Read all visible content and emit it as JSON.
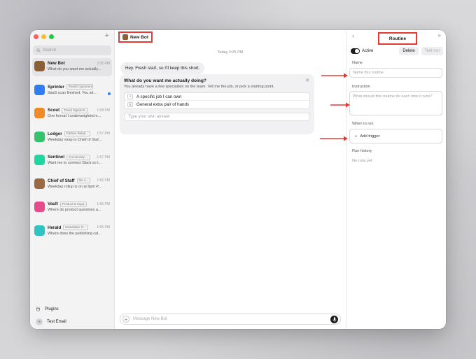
{
  "sidebar": {
    "search_placeholder": "Search",
    "bots": [
      {
        "name": "New Bot",
        "tag": "",
        "time": "2:25 PM",
        "preview": "What do you want me actually...",
        "color": "#8b5e34",
        "active": true,
        "unread": false
      },
      {
        "name": "Sprinter",
        "tag": "Reddit Opportunit...",
        "time": "",
        "preview": "SaaS scan finished. You alr...",
        "color": "#2f7cf6",
        "active": false,
        "unread": true
      },
      {
        "name": "Scout",
        "tag": "Trend Signal R...",
        "time": "1:58 PM",
        "preview": "One format I underweighted o...",
        "color": "#f08a24",
        "active": false,
        "unread": false
      },
      {
        "name": "Ledger",
        "tag": "Partner Relati...",
        "time": "1:57 PM",
        "preview": "Weekday wrap to Chief of Staf...",
        "color": "#35c26b",
        "active": false,
        "unread": false
      },
      {
        "name": "Sentinel",
        "tag": "Community ...",
        "time": "1:57 PM",
        "preview": "Want me to connect Slack so I...",
        "color": "#1ed6a0",
        "active": false,
        "unread": false
      },
      {
        "name": "Chief of Staff",
        "tag": "the o...",
        "time": "1:56 PM",
        "preview": "Weekday rollup is on at 6pm P...",
        "color": "#9a6a44",
        "active": false,
        "unread": false
      },
      {
        "name": "Vault",
        "tag": "Product & Supp...",
        "time": "1:56 PM",
        "preview": "Where do product questions a...",
        "color": "#e84b8a",
        "active": false,
        "unread": false
      },
      {
        "name": "Herald",
        "tag": "Newsletter O...",
        "time": "1:55 PM",
        "preview": "Where does the publishing cal...",
        "color": "#2ec4c4",
        "active": false,
        "unread": false
      }
    ],
    "plugins_label": "Plugins",
    "user_initials": "TE",
    "user_name": "Test Email"
  },
  "chat": {
    "title": "New Bot",
    "timestamp": "Today 2:25 PM",
    "message": "Hey. Fresh start, so I'll keep this short.",
    "question": {
      "title": "What do you want me actually doing?",
      "subtitle": "You already have a few specialists on the team. Tell me the job, or pick a starting point.",
      "options": [
        {
          "key": "A",
          "label": "A specific job I can own"
        },
        {
          "key": "B",
          "label": "General extra pair of hands"
        }
      ],
      "input_placeholder": "Type your own answer"
    },
    "composer_placeholder": "Message New Bot"
  },
  "routine": {
    "title": "Routine",
    "active_label": "Active",
    "delete_label": "Delete",
    "test_run_label": "Test run",
    "name_label": "Name",
    "name_placeholder": "Name this routine",
    "instruction_label": "Instruction",
    "instruction_placeholder": "What should this routine do each time it runs?",
    "when_label": "When to run",
    "add_trigger_label": "Add trigger",
    "history_label": "Run history",
    "no_runs": "No runs yet"
  },
  "colors": {
    "annotation_red": "#e53935"
  }
}
